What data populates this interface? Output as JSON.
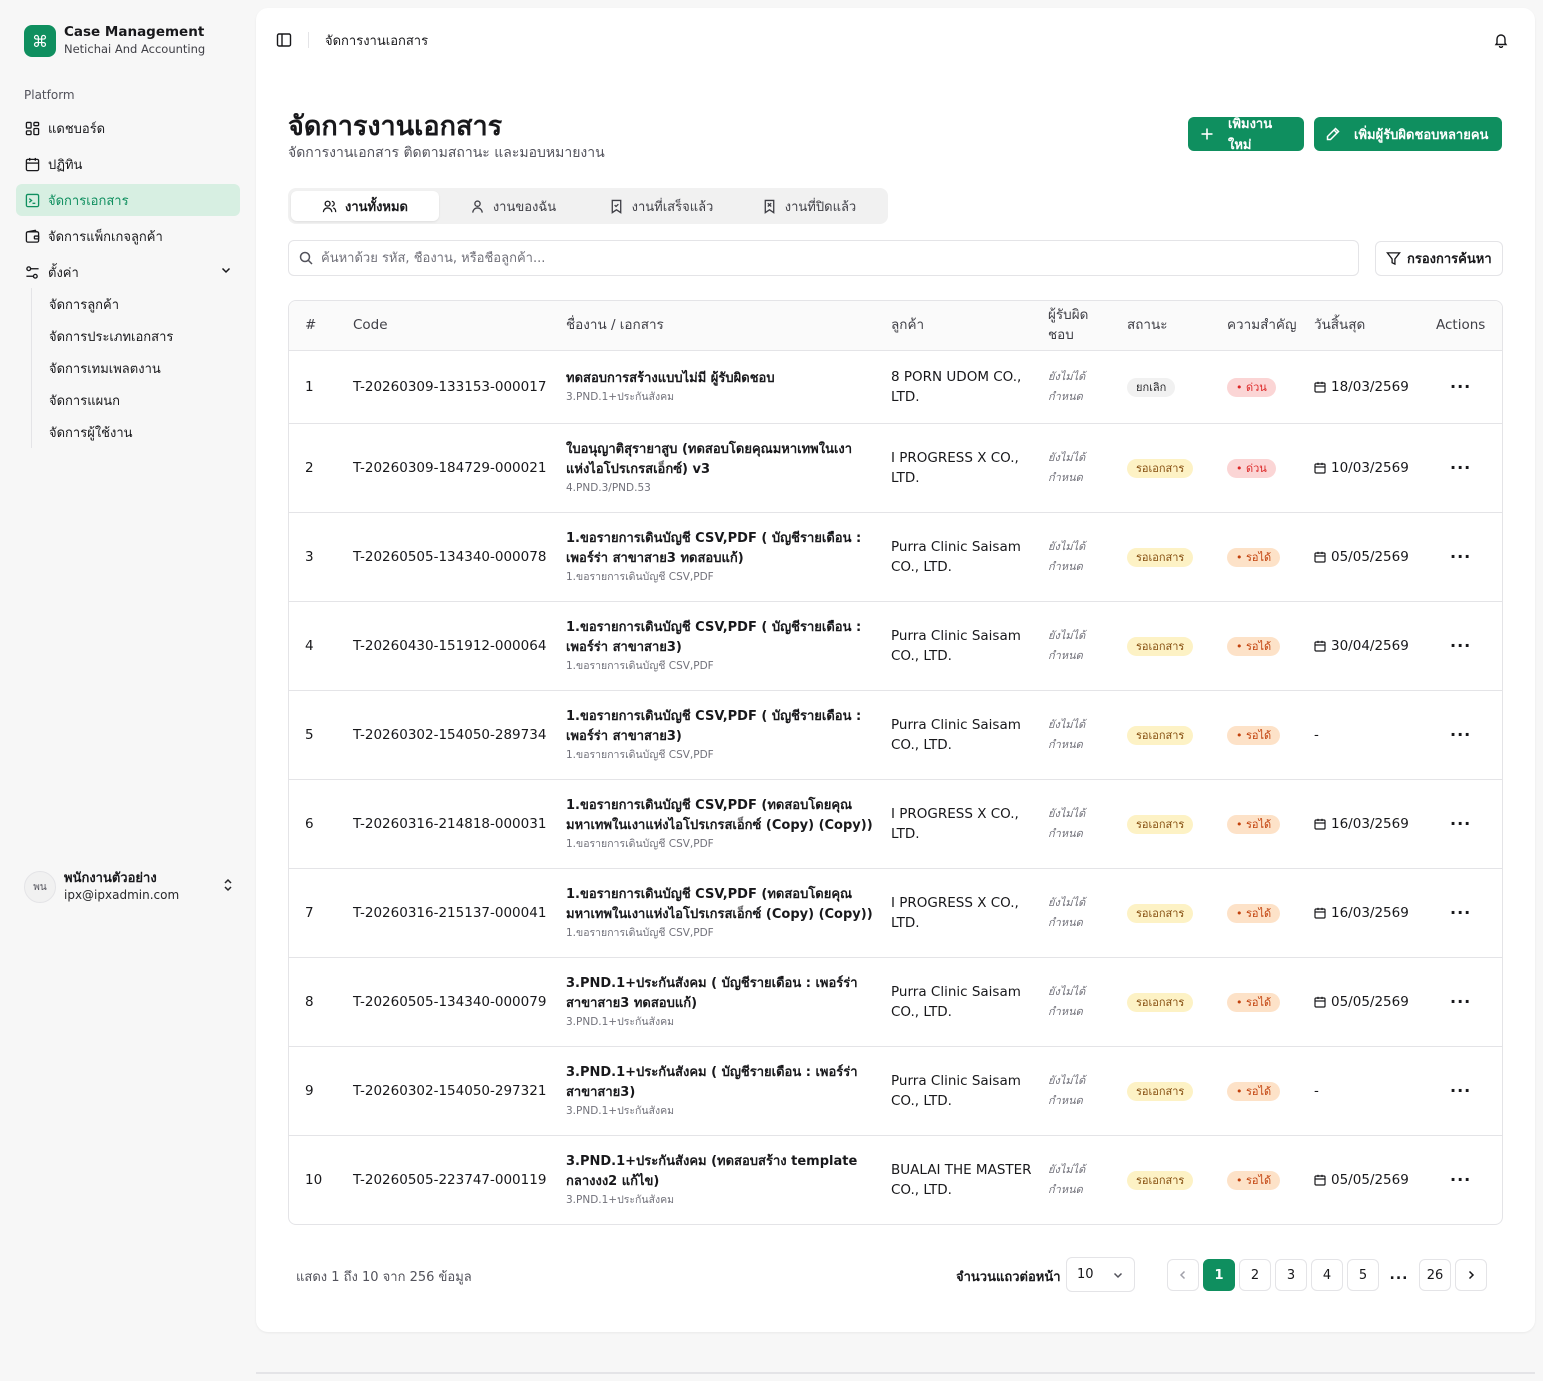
{
  "brand": {
    "title": "Case Management",
    "subtitle": "Netichai And Accounting"
  },
  "sidebar": {
    "section_label": "Platform",
    "items": [
      {
        "label": "แดชบอร์ด",
        "icon": "dashboard-icon",
        "active": false
      },
      {
        "label": "ปฏิทิน",
        "icon": "calendar-icon",
        "active": false
      },
      {
        "label": "จัดการเอกสาร",
        "icon": "document-icon",
        "active": true
      },
      {
        "label": "จัดการแพ็กเกจลูกค้า",
        "icon": "wallet-icon",
        "active": false
      },
      {
        "label": "ตั้งค่า",
        "icon": "settings-icon",
        "active": false,
        "expanded": true
      }
    ],
    "sub_items": [
      "จัดการลูกค้า",
      "จัดการประเภทเอกสาร",
      "จัดการเทมเพลตงาน",
      "จัดการแผนก",
      "จัดการผู้ใช้งาน"
    ]
  },
  "user": {
    "initials": "พน",
    "name": "พนักงานตัวอย่าง",
    "email": "ipx@ipxadmin.com"
  },
  "topbar": {
    "breadcrumb": "จัดการงานเอกสาร"
  },
  "header": {
    "title": "จัดการงานเอกสาร",
    "subtitle": "จัดการงานเอกสาร ติดตามสถานะ และมอบหมายงาน",
    "add_button": "เพิ่มงานใหม่",
    "multi_assign_button": "เพิ่มผู้รับผิดชอบหลายคน"
  },
  "tabs": [
    {
      "label": "งานทั้งหมด",
      "active": true
    },
    {
      "label": "งานของฉัน",
      "active": false
    },
    {
      "label": "งานที่เสร็จแล้ว",
      "active": false
    },
    {
      "label": "งานที่ปิดแล้ว",
      "active": false
    }
  ],
  "search": {
    "placeholder": "ค้นหาด้วย รหัส, ชื่องาน, หรือชื่อลูกค้า...",
    "value": ""
  },
  "filter_button": "กรองการค้นหา",
  "table": {
    "columns": [
      "#",
      "Code",
      "ชื่องาน / เอกสาร",
      "ลูกค้า",
      "ผู้รับผิดชอบ",
      "สถานะ",
      "ความสำคัญ",
      "วันสิ้นสุด",
      "Actions"
    ],
    "rows": [
      {
        "no": "1",
        "code": "T-20260309-133153-000017",
        "title": "ทดสอบการสร้างแบบไม่มี ผู้รับผิดชอบ",
        "sub": "3.PND.1+ประกันสังคม",
        "customer": "8 PORN UDOM CO., LTD.",
        "assignee": "ยังไม่ได้กำหนด",
        "status": "ยกเลิก",
        "status_type": "cancel",
        "priority": "• ด่วน",
        "priority_type": "urgent",
        "due": "18/03/2569"
      },
      {
        "no": "2",
        "code": "T-20260309-184729-000021",
        "title": "ใบอนุญาติสุรายาสูบ (ทดสอบโดยคุณมหาเทพในเงาแห่งไอโปรเกรสเอ็กซ์) v3",
        "sub": "4.PND.3/PND.53",
        "customer": "I PROGRESS X CO., LTD.",
        "assignee": "ยังไม่ได้กำหนด",
        "status": "รอเอกสาร",
        "status_type": "wait",
        "priority": "• ด่วน",
        "priority_type": "urgent",
        "due": "10/03/2569"
      },
      {
        "no": "3",
        "code": "T-20260505-134340-000078",
        "title": "1.ขอรายการเดินบัญชี CSV,PDF ( บัญชีรายเดือน : เพอร์ร่า สาขาสาย3 ทดสอบแก้)",
        "sub": "1.ขอรายการเดินบัญชี CSV,PDF",
        "customer": "Purra Clinic Saisam CO., LTD.",
        "assignee": "ยังไม่ได้กำหนด",
        "status": "รอเอกสาร",
        "status_type": "wait",
        "priority": "• รอได้",
        "priority_type": "waitok",
        "due": "05/05/2569"
      },
      {
        "no": "4",
        "code": "T-20260430-151912-000064",
        "title": "1.ขอรายการเดินบัญชี CSV,PDF ( บัญชีรายเดือน : เพอร์ร่า สาขาสาย3)",
        "sub": "1.ขอรายการเดินบัญชี CSV,PDF",
        "customer": "Purra Clinic Saisam CO., LTD.",
        "assignee": "ยังไม่ได้กำหนด",
        "status": "รอเอกสาร",
        "status_type": "wait",
        "priority": "• รอได้",
        "priority_type": "waitok",
        "due": "30/04/2569"
      },
      {
        "no": "5",
        "code": "T-20260302-154050-289734",
        "title": "1.ขอรายการเดินบัญชี CSV,PDF ( บัญชีรายเดือน : เพอร์ร่า สาขาสาย3)",
        "sub": "1.ขอรายการเดินบัญชี CSV,PDF",
        "customer": "Purra Clinic Saisam CO., LTD.",
        "assignee": "ยังไม่ได้กำหนด",
        "status": "รอเอกสาร",
        "status_type": "wait",
        "priority": "• รอได้",
        "priority_type": "waitok",
        "due": "-"
      },
      {
        "no": "6",
        "code": "T-20260316-214818-000031",
        "title": "1.ขอรายการเดินบัญชี CSV,PDF (ทดสอบโดยคุณมหาเทพในเงาแห่งไอโปรเกรสเอ็กซ์ (Copy) (Copy))",
        "sub": "1.ขอรายการเดินบัญชี CSV,PDF",
        "customer": "I PROGRESS X CO., LTD.",
        "assignee": "ยังไม่ได้กำหนด",
        "status": "รอเอกสาร",
        "status_type": "wait",
        "priority": "• รอได้",
        "priority_type": "waitok",
        "due": "16/03/2569"
      },
      {
        "no": "7",
        "code": "T-20260316-215137-000041",
        "title": "1.ขอรายการเดินบัญชี CSV,PDF (ทดสอบโดยคุณมหาเทพในเงาแห่งไอโปรเกรสเอ็กซ์ (Copy) (Copy))",
        "sub": "1.ขอรายการเดินบัญชี CSV,PDF",
        "customer": "I PROGRESS X CO., LTD.",
        "assignee": "ยังไม่ได้กำหนด",
        "status": "รอเอกสาร",
        "status_type": "wait",
        "priority": "• รอได้",
        "priority_type": "waitok",
        "due": "16/03/2569"
      },
      {
        "no": "8",
        "code": "T-20260505-134340-000079",
        "title": "3.PND.1+ประกันสังคม ( บัญชีรายเดือน : เพอร์ร่า สาขาสาย3 ทดสอบแก้)",
        "sub": "3.PND.1+ประกันสังคม",
        "customer": "Purra Clinic Saisam CO., LTD.",
        "assignee": "ยังไม่ได้กำหนด",
        "status": "รอเอกสาร",
        "status_type": "wait",
        "priority": "• รอได้",
        "priority_type": "waitok",
        "due": "05/05/2569"
      },
      {
        "no": "9",
        "code": "T-20260302-154050-297321",
        "title": "3.PND.1+ประกันสังคม ( บัญชีรายเดือน : เพอร์ร่า สาขาสาย3)",
        "sub": "3.PND.1+ประกันสังคม",
        "customer": "Purra Clinic Saisam CO., LTD.",
        "assignee": "ยังไม่ได้กำหนด",
        "status": "รอเอกสาร",
        "status_type": "wait",
        "priority": "• รอได้",
        "priority_type": "waitok",
        "due": "-"
      },
      {
        "no": "10",
        "code": "T-20260505-223747-000119",
        "title": "3.PND.1+ประกันสังคม (ทดสอบสร้าง template กลางงง2 แก้ไข)",
        "sub": "3.PND.1+ประกันสังคม",
        "customer": "BUALAI THE MASTER CO., LTD.",
        "assignee": "ยังไม่ได้กำหนด",
        "status": "รอเอกสาร",
        "status_type": "wait",
        "priority": "• รอได้",
        "priority_type": "waitok",
        "due": "05/05/2569"
      }
    ]
  },
  "footer": {
    "info": "แสดง 1 ถึง 10 จาก 256 ข้อมูล",
    "rows_label": "จำนวนแถวต่อหน้า",
    "rows_value": "10",
    "pages": [
      "1",
      "2",
      "3",
      "4",
      "5"
    ],
    "current_page": "1",
    "ellipsis": "...",
    "last_page": "26"
  },
  "colors": {
    "accent": "#0f8f5f",
    "accent_light": "#d7efe2"
  }
}
